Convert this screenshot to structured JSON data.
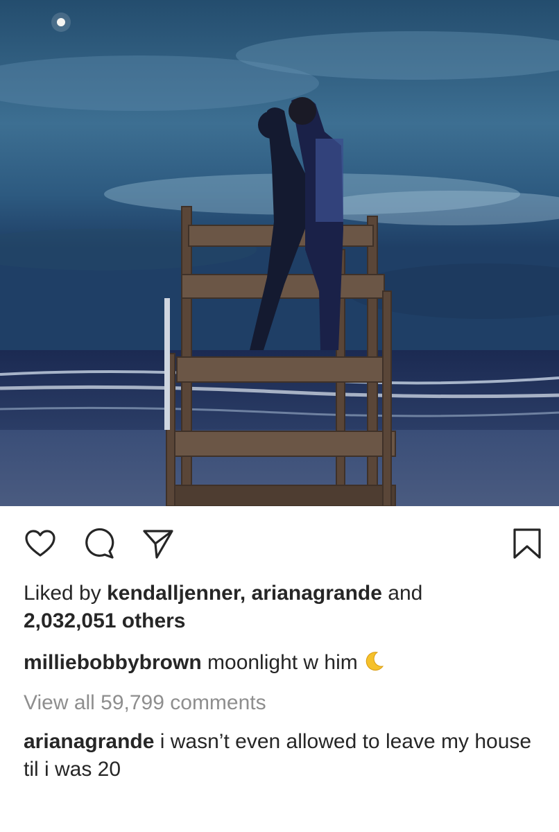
{
  "post": {
    "photo_description_icon": "photo"
  },
  "actions": {
    "like_icon": "heart-icon",
    "comment_icon": "comment-icon",
    "share_icon": "share-icon",
    "save_icon": "bookmark-icon"
  },
  "likes": {
    "prefix": "Liked by",
    "user1": "kendalljenner,",
    "user2": "arianagrande",
    "and": "and",
    "others": "2,032,051 others"
  },
  "caption": {
    "username": "milliebobbybrown",
    "text": "moonlight w him",
    "emoji": "crescent-moon"
  },
  "comments": {
    "view_all": "View all 59,799 comments",
    "top": {
      "username": "arianagrande",
      "text": "i wasn’t even allowed to leave my house til i was 20"
    }
  },
  "colors": {
    "text": "#262626",
    "muted": "#8e8e8e",
    "sky": "#2f5c7e"
  }
}
